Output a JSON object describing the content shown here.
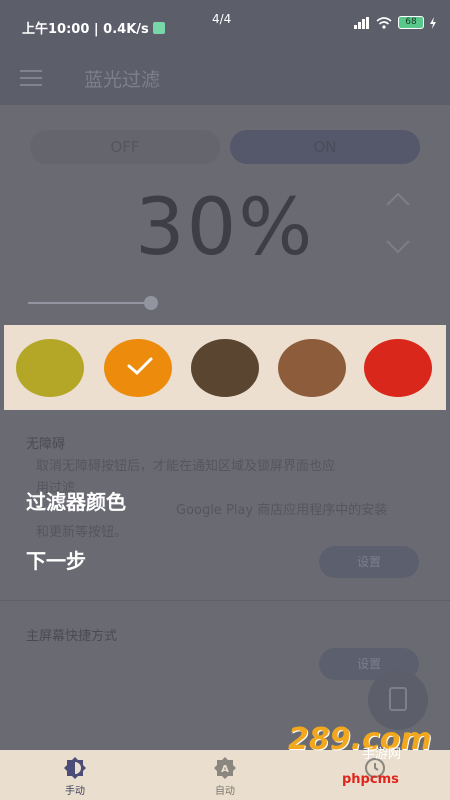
{
  "status_bar": {
    "time": "上午10:00 | 0.4K/s",
    "page_indicator": "4/4",
    "battery": "68"
  },
  "app_bar": {
    "title": "蓝光过滤"
  },
  "filter": {
    "off_label": "OFF",
    "on_label": "ON",
    "intensity_text": "30%",
    "intensity_fraction": 0.3
  },
  "colors": {
    "swatches": [
      "#b4a626",
      "#ec8b0c",
      "#5a4530",
      "#8d5c3b",
      "#d9271b"
    ],
    "selected_index": 1,
    "panel_bg": "#ecdfcf"
  },
  "accessibility": {
    "title": "无障碍",
    "desc_line1": "取消无障碍按钮后，才能在通知区域及锁屏界面也应",
    "desc_line2": "用过滤",
    "desc_line3": "Google Play 商店应用程序中的安装",
    "desc_line4": "和更新等按钮。",
    "button_label": "设置"
  },
  "shortcut": {
    "title": "主屏幕快捷方式",
    "button_label": "设置"
  },
  "overlay": {
    "title": "过滤器颜色",
    "next": "下一步"
  },
  "bottom_nav": {
    "items": [
      {
        "label": "手动",
        "icon": "brightness-icon"
      },
      {
        "label": "自动",
        "icon": "auto-icon"
      },
      {
        "label": "",
        "icon": "timer-icon"
      }
    ]
  },
  "watermark": {
    "logo": "289.com",
    "sub": "手游网",
    "site": "phpcms"
  }
}
